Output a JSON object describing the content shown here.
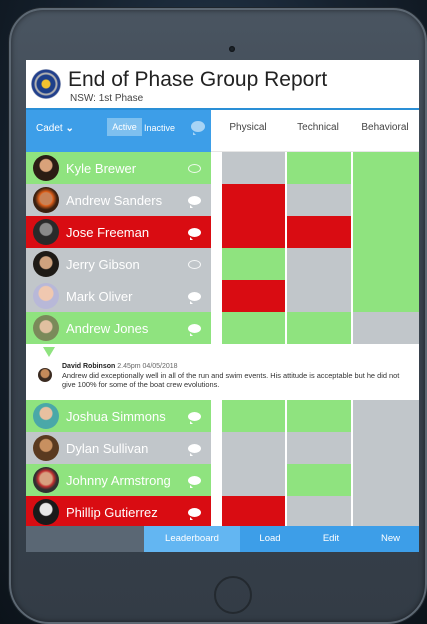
{
  "header": {
    "title": "End of Phase Group Report",
    "subtitle": "NSW: 1st Phase",
    "logo_icon": "navy-seal-emblem"
  },
  "filter": {
    "cadet_label": "Cadet",
    "active_label": "Active",
    "inactive_label": "Inactive",
    "comment_icon": "speech-bubble-icon"
  },
  "columns": [
    "Physical",
    "Technical",
    "Behavioral"
  ],
  "colors": {
    "green": "#8fe37f",
    "gray": "#c1c6ca",
    "red": "#d90c12",
    "accent": "#3d9ee8"
  },
  "rows": [
    {
      "name": "Kyle Brewer",
      "status": "green",
      "comment": "outline",
      "cells": [
        "gray",
        "green",
        "green"
      ]
    },
    {
      "name": "Andrew Sanders",
      "status": "gray",
      "comment": "filled",
      "cells": [
        "red",
        "gray",
        "green"
      ]
    },
    {
      "name": "Jose Freeman",
      "status": "red",
      "comment": "filled",
      "cells": [
        "red",
        "red",
        "green"
      ]
    },
    {
      "name": "Jerry Gibson",
      "status": "gray",
      "comment": "outline",
      "cells": [
        "green",
        "gray",
        "green"
      ]
    },
    {
      "name": "Mark Oliver",
      "status": "gray",
      "comment": "filled",
      "cells": [
        "red",
        "gray",
        "green"
      ]
    },
    {
      "name": "Andrew Jones",
      "status": "green",
      "comment": "filled",
      "cells": [
        "green",
        "green",
        "gray"
      ]
    },
    {
      "name": "Joshua Simmons",
      "status": "green",
      "comment": "filled",
      "cells": [
        "green",
        "green",
        "gray"
      ]
    },
    {
      "name": "Dylan Sullivan",
      "status": "gray",
      "comment": "filled",
      "cells": [
        "gray",
        "gray",
        "gray"
      ]
    },
    {
      "name": "Johnny Armstrong",
      "status": "green",
      "comment": "filled",
      "cells": [
        "gray",
        "green",
        "gray"
      ]
    },
    {
      "name": "Phillip Gutierrez",
      "status": "red",
      "comment": "filled",
      "cells": [
        "red",
        "gray",
        "gray"
      ]
    }
  ],
  "comment": {
    "author": "David Robinson",
    "time": "2.45pm 04/05/2018",
    "text": "Andrew did exceptionally well in all of the run and swim events. His attitude is acceptable but he did not give 100% for some of the boat crew evolutions."
  },
  "bottom_tabs": [
    "Leaderboard",
    "Load",
    "Edit",
    "New"
  ],
  "selected_tab": "Leaderboard"
}
